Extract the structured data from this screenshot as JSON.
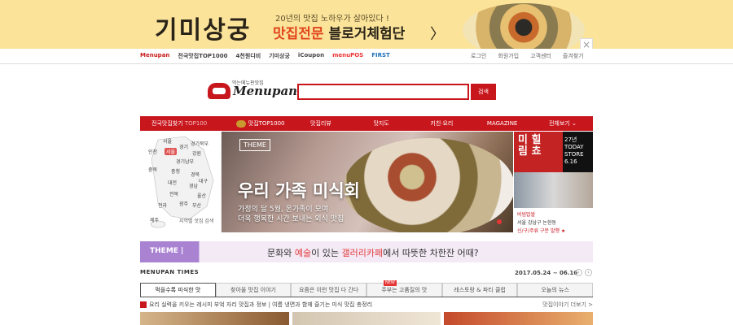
{
  "banner": {
    "logo": "기미상궁",
    "sub": "20년의 맛집 노하우가 살아있다 !",
    "main_hl": "맛집전문",
    "main": " 블로거체험단",
    "arrow": "〉",
    "close": "×"
  },
  "gnb": {
    "links": [
      "Menupan",
      "전국맛집TOP1000",
      "4천원디비",
      "기미상궁",
      "iCoupon",
      "menuPOS",
      "FIRST"
    ],
    "util": [
      "로그인",
      "회원가입",
      "고객센터",
      "즐겨찾기"
    ]
  },
  "brand": {
    "small": "먹는메뉴판맛집",
    "name": "Menupan"
  },
  "search": {
    "value": "",
    "button": "검색"
  },
  "nav": {
    "items": [
      "전국맛집찾기",
      "맛집TOP1000",
      "맛집리뷰",
      "맛지도",
      "키친·요리",
      "MAGAZINE",
      "전체보기 ⌄"
    ],
    "sub": " TOP100"
  },
  "map": {
    "regions": [
      "서울",
      "인천",
      "경기",
      "강원",
      "경기남부",
      "경기북부",
      "충북",
      "충청",
      "대전",
      "경북",
      "경남",
      "대구",
      "전북",
      "전라",
      "광주",
      "울산",
      "부산",
      "제주"
    ],
    "active": "서울",
    "legend": "지역별 맛집 검색"
  },
  "hero": {
    "theme": "THEME",
    "title": "우리 가족 미식회",
    "desc1": "가정의 달 5월, 온가족이 모여",
    "desc2": "더욱 행복한 시간 보내는 외식 맛집"
  },
  "side": {
    "big": "미 힐\n림 쵸",
    "badge": "27년\nTODAY\nSTORE\n6.16",
    "t1": "비빔밥쌀",
    "t2": "서울 강남구 논현동",
    "t3": "신/구/주류 구분 발행 ★"
  },
  "strip": {
    "tag": "THEME  |",
    "text_pre": "문화와 ",
    "text_hl1": "예술",
    "text_mid": "이 있는 ",
    "text_hl2": "갤러리카페",
    "text_post": "에서 따뜻한 차한잔 어때?"
  },
  "times": {
    "title": "MENUPAN TIMES",
    "date": "2017.05.24 ~ 06.16",
    "prev": "‹",
    "next": "›"
  },
  "tabs": [
    "먹을수록 미식한 맛",
    "찾아올 맛집 이야기",
    "요즘은 이런 맛집 다 간다",
    "주부는 고품질의 맛",
    "레스토랑 & 파티 클럽",
    "오늘의 뉴스"
  ],
  "news": {
    "text": "요리 실력을 키우는 레시피 부엌 자리 맛집과 정보 | 여름 냉면과 함께 즐기는 미식 맛집 총정리",
    "more": "맛집이야기 더보기 >"
  },
  "colors": {
    "brand_red": "#c8161d",
    "banner_yellow": "#fbe39a",
    "theme_purple": "#a983d2"
  }
}
